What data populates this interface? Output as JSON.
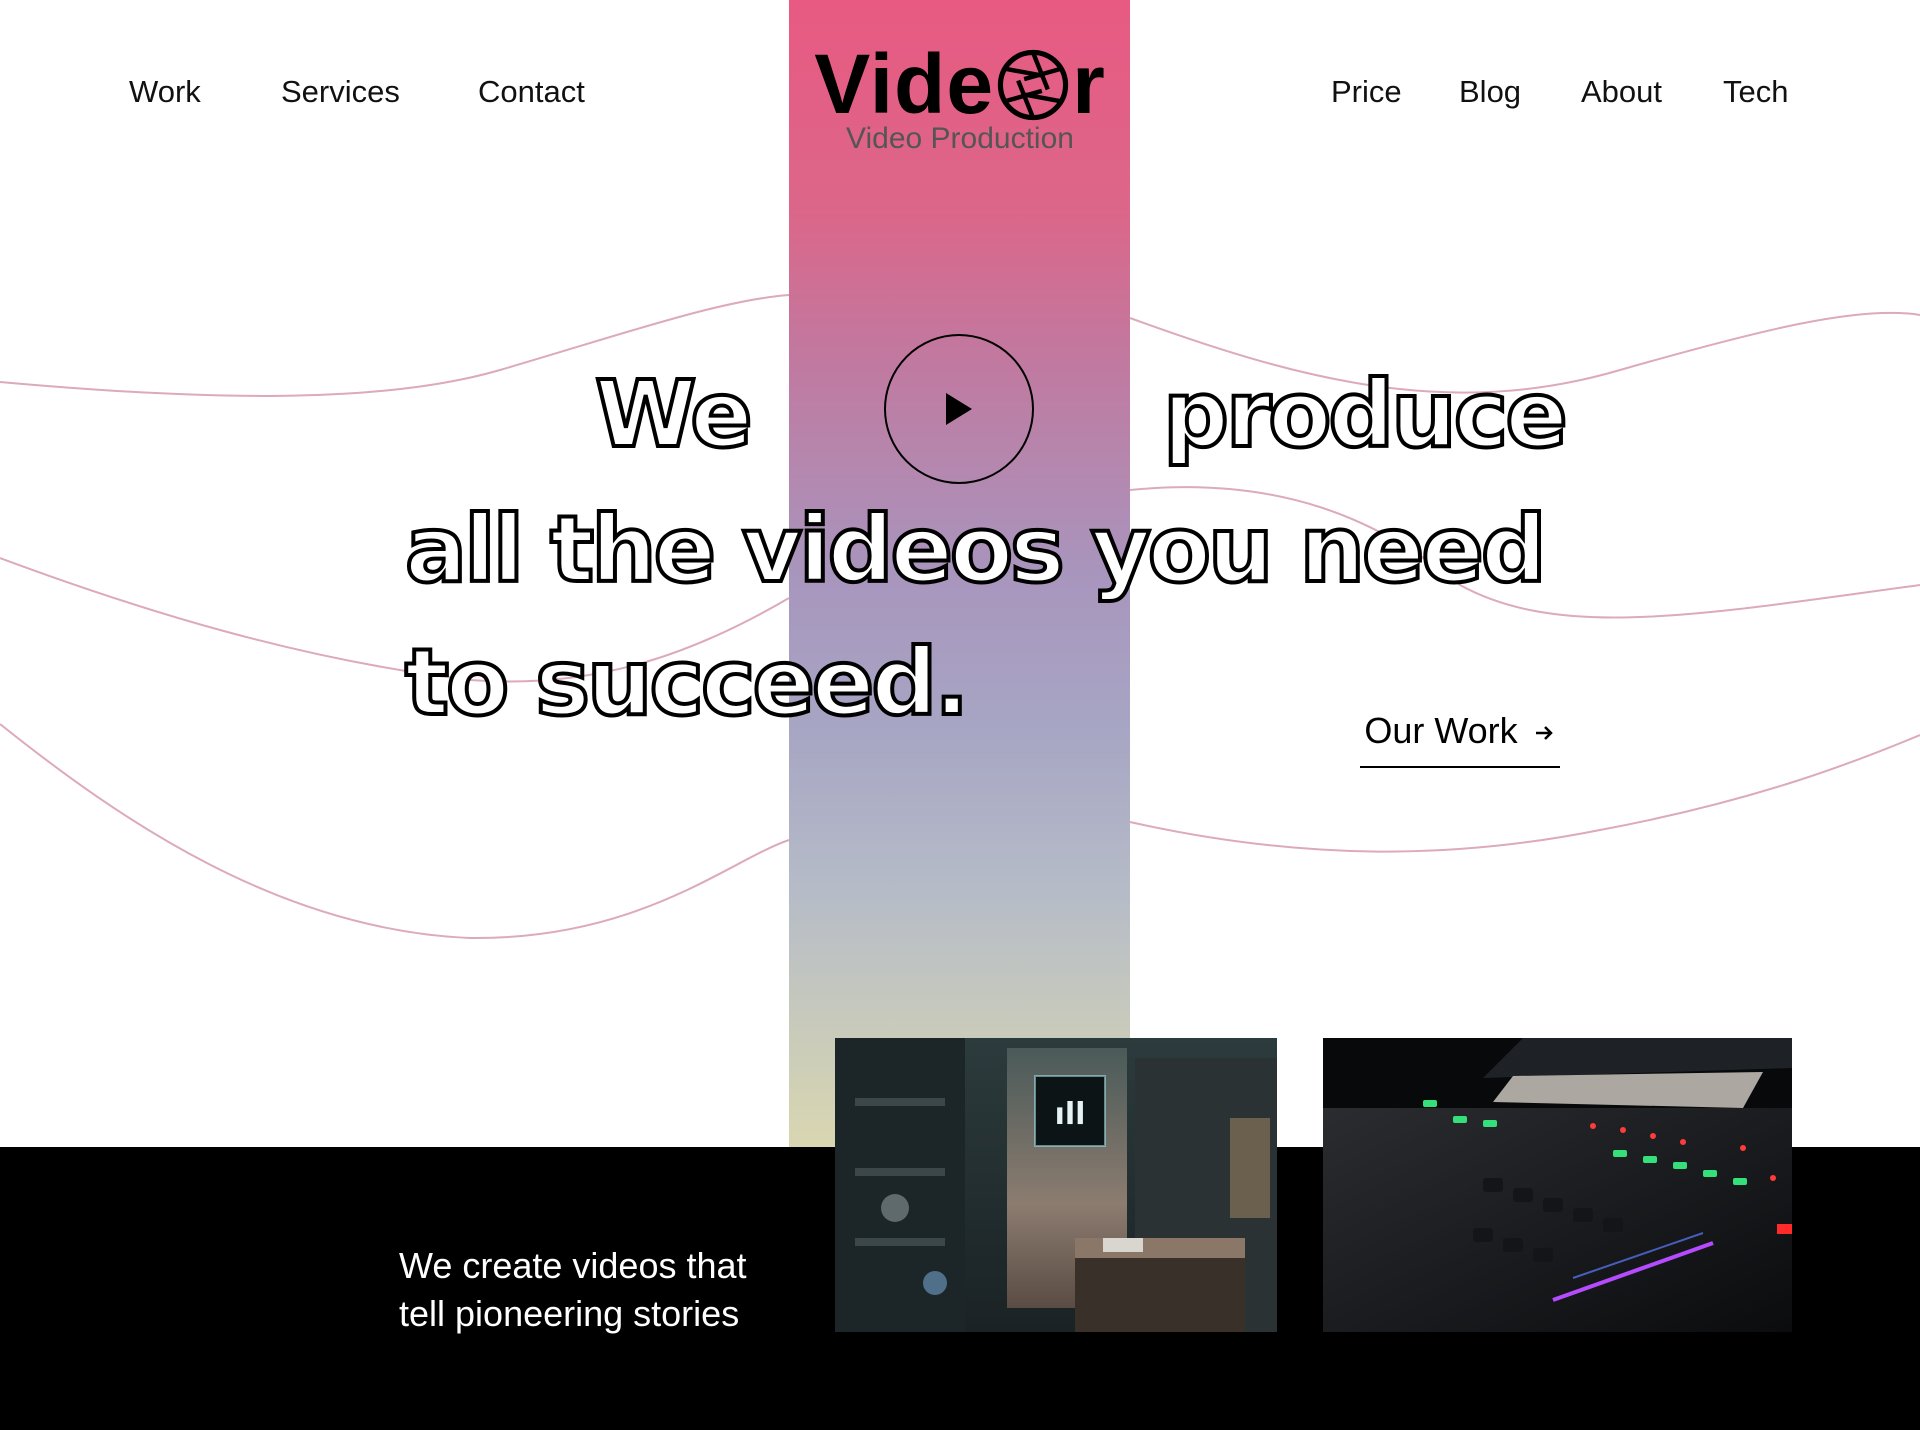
{
  "brand": {
    "name_part1": "Vide",
    "name_part2": "r",
    "subtitle": "Video Production",
    "accent_gradient": [
      "#e85a82",
      "#a895bd",
      "#d9d7b1"
    ]
  },
  "nav": {
    "left": [
      "Work",
      "Services",
      "Contact"
    ],
    "right": [
      "Price",
      "Blog",
      "About",
      "Tech"
    ]
  },
  "hero": {
    "line1_a": "We",
    "line1_b": "produce",
    "line2": "all the videos you need",
    "line3": "to succeed.",
    "cta_label": "Our Work",
    "cta_icon": "arrow-right-icon",
    "play_icon": "play-icon"
  },
  "footer": {
    "tagline_line1": "We create videos that",
    "tagline_line2": "tell pioneering stories",
    "photos": [
      "studio-room-photo",
      "mixing-console-photo"
    ]
  },
  "colors": {
    "wave": "#dcaab8",
    "footer_bg": "#000000"
  }
}
